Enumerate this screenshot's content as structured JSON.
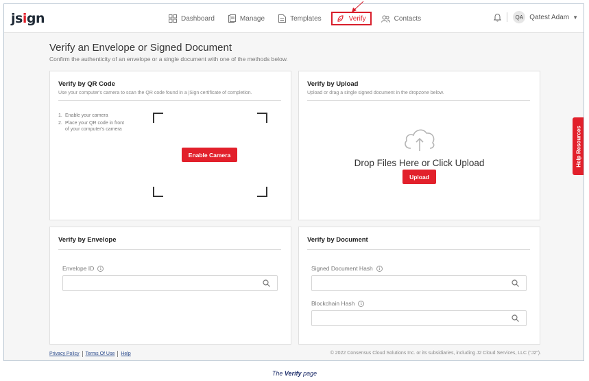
{
  "brand": {
    "logo_pre": "js",
    "logo_i": "i",
    "logo_post": "gn"
  },
  "nav": {
    "dashboard": "Dashboard",
    "manage": "Manage",
    "templates": "Templates",
    "verify": "Verify",
    "contacts": "Contacts"
  },
  "user": {
    "initials": "QA",
    "name": "Qatest Adam"
  },
  "page": {
    "title": "Verify an Envelope or Signed Document",
    "subtitle": "Confirm the authenticity of an envelope or a single document with one of the methods below."
  },
  "qr": {
    "title": "Verify by QR Code",
    "subtitle": "Use your computer's camera to scan the QR code found in a jSign certificate of completion.",
    "steps": [
      {
        "num": "1.",
        "text": "Enable your camera"
      },
      {
        "num": "2.",
        "text": "Place your QR code in front of your computer's camera"
      }
    ],
    "button": "Enable Camera"
  },
  "upload": {
    "title": "Verify by Upload",
    "subtitle": "Upload or drag a single signed document in the dropzone below.",
    "drop_text": "Drop Files Here or Click Upload",
    "button": "Upload"
  },
  "envelope": {
    "title": "Verify by Envelope",
    "field_label": "Envelope ID",
    "field_value": ""
  },
  "document": {
    "title": "Verify by Document",
    "hash_label": "Signed Document Hash",
    "hash_value": "",
    "blockchain_label": "Blockchain Hash",
    "blockchain_value": ""
  },
  "help_tab": "Help Resources",
  "footer": {
    "privacy": "Privacy Policy",
    "terms": "Terms Of Use",
    "help": "Help",
    "copyright": "© 2022 Consensus Cloud Solutions Inc. or its subsidiaries, including J2 Cloud Services, LLC (\"J2\")."
  },
  "caption": {
    "pre": "The ",
    "bold": "Verify",
    "post": " page"
  },
  "colors": {
    "accent": "#e2202b",
    "link": "#2a4a8c",
    "caption": "#1f2f6b"
  }
}
